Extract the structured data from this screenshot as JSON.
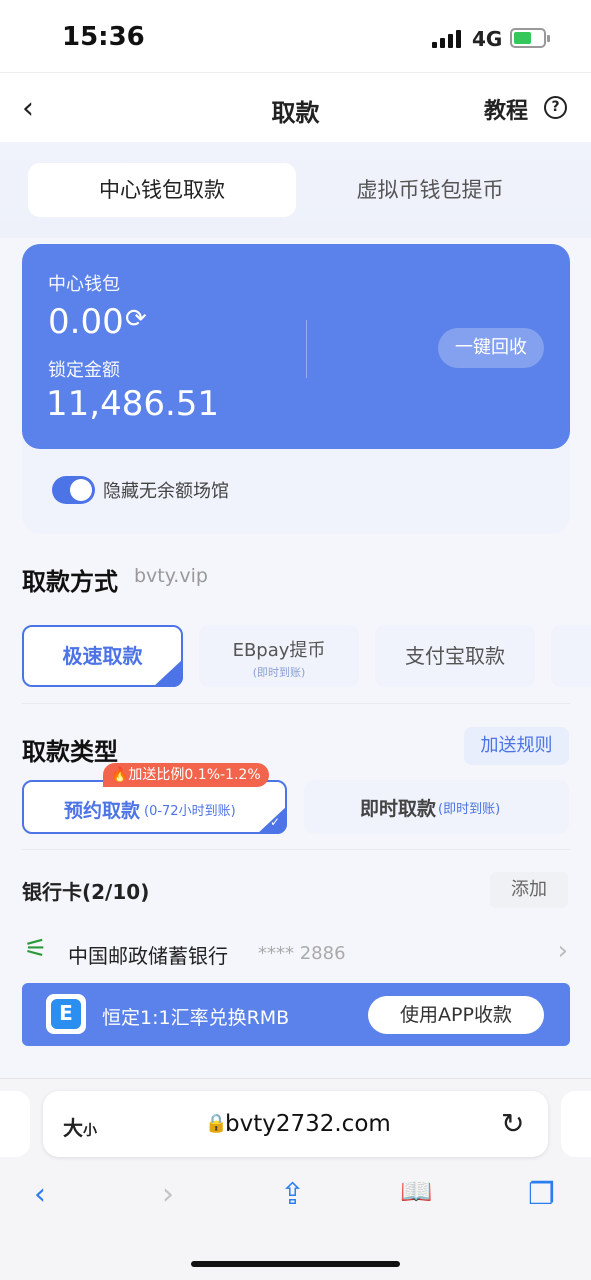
{
  "status_bar": {
    "time": "15:36",
    "network": "4G"
  },
  "nav": {
    "back_icon": "‹",
    "title": "取款",
    "tutorial": "教程",
    "help_icon": "?"
  },
  "tabs": [
    {
      "label": "中心钱包取款",
      "active": true
    },
    {
      "label": "虚拟币钱包提币",
      "active": false
    }
  ],
  "wallet": {
    "center_label": "中心钱包",
    "center_balance": "0.00",
    "locked_label": "锁定金额",
    "locked_amount": "11,486.51",
    "recall_button": "一键回收"
  },
  "toggle": {
    "label": "隐藏无余额场馆",
    "on": true
  },
  "method_section": {
    "title": "取款方式",
    "subtitle": "bvty.vip"
  },
  "methods": [
    {
      "label": "极速取款",
      "sub": "",
      "active": true
    },
    {
      "label": "EBpay提币",
      "sub": "(即时到账)",
      "active": false
    },
    {
      "label": "支付宝取款",
      "sub": "",
      "active": false
    }
  ],
  "type_section": {
    "title": "取款类型",
    "bonus_rule": "加送规则",
    "bonus_badge": "🔥加送比例0.1%-1.2%"
  },
  "types": [
    {
      "label": "预约取款",
      "sub": "(0-72小时到账)",
      "active": true
    },
    {
      "label": "即时取款",
      "sub": "(即时到账)",
      "active": false
    }
  ],
  "bank": {
    "title": "银行卡(2/10)",
    "add_button": "添加",
    "card_name": "中国邮政储蓄银行",
    "card_number": "**** 2886"
  },
  "promo": {
    "icon_letter": "E",
    "text": "恒定1:1汇率兑换RMB",
    "button": "使用APP收款"
  },
  "browser": {
    "text_size_big": "大",
    "text_size_small": "小",
    "url": "bvty2732.com",
    "reload_icon": "↻",
    "toolbar": [
      "‹",
      "›",
      "⇪",
      "📖",
      "❐"
    ]
  },
  "colors": {
    "accent": "#4d74e6",
    "card": "#5b82ea",
    "badge": "#f2644b"
  }
}
